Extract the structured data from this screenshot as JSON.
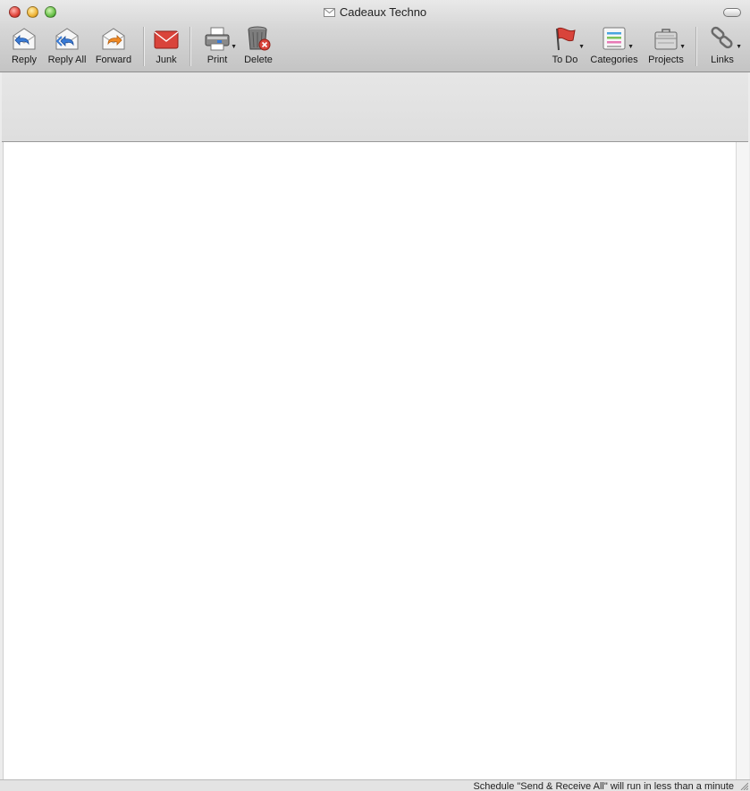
{
  "window": {
    "title": "Cadeaux Techno"
  },
  "toolbar": {
    "items": [
      {
        "label": "Reply",
        "icon": "reply-icon"
      },
      {
        "label": "Reply All",
        "icon": "reply-all-icon"
      },
      {
        "label": "Forward",
        "icon": "forward-icon"
      },
      {
        "label": "Junk",
        "icon": "junk-icon"
      },
      {
        "label": "Print",
        "icon": "printer-icon"
      },
      {
        "label": "Delete",
        "icon": "trash-delete-icon"
      },
      {
        "label": "To Do",
        "icon": "flag-icon"
      },
      {
        "label": "Categories",
        "icon": "categories-icon"
      },
      {
        "label": "Projects",
        "icon": "briefcase-icon"
      },
      {
        "label": "Links",
        "icon": "chain-link-icon"
      }
    ]
  },
  "status": {
    "text": "Schedule \"Send & Receive All\" will run in less than a minute"
  },
  "colors": {
    "accent_red": "#d9443b",
    "reply_blue": "#3a7bd5",
    "forward_orange": "#f08a24"
  }
}
